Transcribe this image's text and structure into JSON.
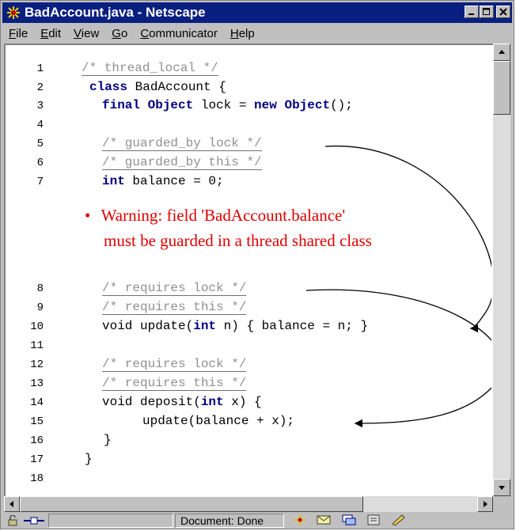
{
  "window": {
    "title": "BadAccount.java - Netscape"
  },
  "menu": [
    {
      "label": "File",
      "mnemonic": "F",
      "rest": "ile"
    },
    {
      "label": "Edit",
      "mnemonic": "E",
      "rest": "dit"
    },
    {
      "label": "View",
      "mnemonic": "V",
      "rest": "iew"
    },
    {
      "label": "Go",
      "mnemonic": "G",
      "rest": "o"
    },
    {
      "label": "Communicator",
      "mnemonic": "C",
      "rest": "ommunicator"
    },
    {
      "label": "Help",
      "mnemonic": "H",
      "rest": "elp"
    }
  ],
  "code": {
    "line_numbers": [
      "1",
      "2",
      "3",
      "4",
      "5",
      "6",
      "7",
      "8",
      "9",
      "10",
      "11",
      "12",
      "13",
      "14",
      "15",
      "16",
      "17",
      "18"
    ],
    "l1": "/* thread_local */",
    "l2_kw": "class",
    "l2_rest": " BadAccount {",
    "l3_kw1": "final",
    "l3_kw2": "Object",
    "l3_mid": " lock = ",
    "l3_kw3": "new",
    "l3_kw4": "Object",
    "l3_end": "();",
    "l5": "/* guarded_by lock */",
    "l6": "/* guarded_by this */",
    "l7_kw": "int",
    "l7_rest": " balance = 0;",
    "l8": "/* requires lock */",
    "l9": "/* requires this */",
    "l10_a": "void update(",
    "l10_kw": "int",
    "l10_b": " n) { balance = n; }",
    "l12": "/* requires lock */",
    "l13": "/* requires this */",
    "l14_a": "void deposit(",
    "l14_kw": "int",
    "l14_b": " x) {",
    "l15": "update(balance + x);",
    "l16": "}",
    "l17": "}"
  },
  "warning": {
    "line1": "Warning: field 'BadAccount.balance'",
    "line2": "must be guarded in a thread shared class",
    "color": "#e00000"
  },
  "status": {
    "text": "Document: Done"
  },
  "colors": {
    "titlebar": "#0a2080",
    "keyword": "#000080",
    "comment": "#909090",
    "warning": "#e00000"
  }
}
